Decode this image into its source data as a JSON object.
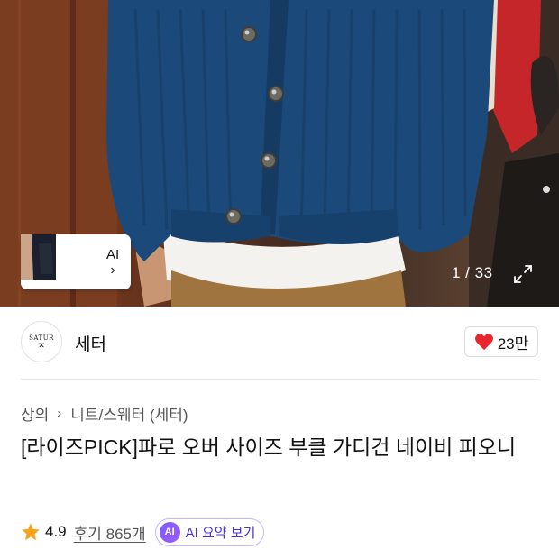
{
  "gallery": {
    "counter": "1 / 33",
    "ai_thumb_label": "AI",
    "ai_thumb_chevron": "›",
    "expand_icon": "expand-icon"
  },
  "brand": {
    "logo_text": "SATUR",
    "logo_mark": "✕",
    "name": "세터"
  },
  "like": {
    "icon": "heart-icon",
    "count": "23만",
    "color": "#e8262e"
  },
  "breadcrumb": {
    "items": [
      "상의",
      "니트/스웨터 (세터)"
    ],
    "separator": "›"
  },
  "product": {
    "title": "[라이즈PICK]파로 오버 사이즈 부클 가디건 네이비 피오니"
  },
  "rating": {
    "icon": "star-icon",
    "value": "4.9",
    "review_text": "후기 865개",
    "star_color": "#f7a21b"
  },
  "ai_summary": {
    "badge": "AI",
    "label": "AI 요약 보기",
    "accent": "#6b3cf0"
  }
}
